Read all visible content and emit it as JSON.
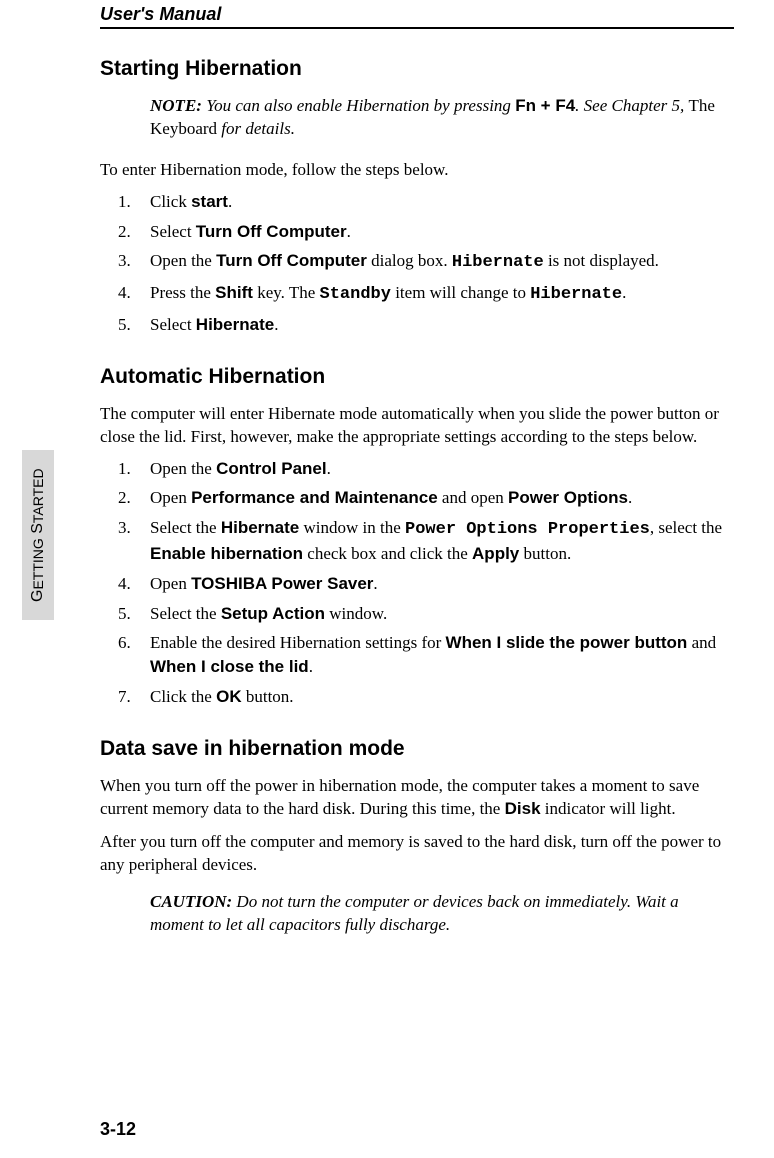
{
  "header": "User's Manual",
  "side_tab_big1": "G",
  "side_tab_small1": "ETTING",
  "side_tab_big2": " S",
  "side_tab_small2": "TARTED",
  "page_number": "3-12",
  "s1": {
    "title": "Starting Hibernation",
    "note_label": "NOTE:",
    "note_a": " You can also enable Hibernation by pressing ",
    "note_key": "Fn + F4",
    "note_b": ". See Chapter 5, ",
    "note_ref": "The Keyboard",
    "note_c": " for details.",
    "intro": "To enter Hibernation mode, follow the steps below.",
    "step1_a": "Click ",
    "step1_b": "start",
    "step1_c": ".",
    "step2_a": "Select ",
    "step2_b": "Turn Off Computer",
    "step2_c": ".",
    "step3_a": "Open the ",
    "step3_b": "Turn Off Computer",
    "step3_c": " dialog box. ",
    "step3_d": "Hibernate",
    "step3_e": " is not displayed.",
    "step4_a": "Press the ",
    "step4_b": "Shift",
    "step4_c": " key. The ",
    "step4_d": "Standby",
    "step4_e": " item will change to ",
    "step4_f": "Hibernate",
    "step4_g": ".",
    "step5_a": "Select ",
    "step5_b": "Hibernate",
    "step5_c": "."
  },
  "s2": {
    "title": "Automatic Hibernation",
    "intro": "The computer will enter Hibernate mode automatically when you slide the power button or close the lid. First, however, make the appropriate settings according to the steps below.",
    "step1_a": "Open the ",
    "step1_b": "Control Panel",
    "step1_c": ".",
    "step2_a": "Open ",
    "step2_b": "Performance and Maintenance",
    "step2_c": " and open ",
    "step2_d": "Power Options",
    "step2_e": ".",
    "step3_a": "Select the ",
    "step3_b": "Hibernate",
    "step3_c": " window in the ",
    "step3_d": "Power Options Properties",
    "step3_e": ", select the ",
    "step3_f": "Enable hibernation",
    "step3_g": " check box and click the ",
    "step3_h": "Apply",
    "step3_i": " button.",
    "step4_a": " Open ",
    "step4_b": "TOSHIBA Power Saver",
    "step4_c": ".",
    "step5_a": "Select the ",
    "step5_b": "Setup Action",
    "step5_c": " window.",
    "step6_a": "Enable the desired Hibernation settings for ",
    "step6_b": "When I slide the power button",
    "step6_c": " and ",
    "step6_d": "When I close the lid",
    "step6_e": ".",
    "step7_a": "Click the ",
    "step7_b": "OK",
    "step7_c": " button."
  },
  "s3": {
    "title": "Data save in hibernation mode",
    "p1_a": "When you turn off the power in hibernation mode, the computer takes a moment to save current memory data to the hard disk. During this time, the ",
    "p1_b": "Disk",
    "p1_c": " indicator will light.",
    "p2": "After you turn off the computer and memory is saved to the hard disk, turn off the power to any peripheral devices.",
    "caution_label": "CAUTION:",
    "caution_text": " Do not turn the computer or devices back on immediately. Wait a moment to let all capacitors fully discharge."
  }
}
